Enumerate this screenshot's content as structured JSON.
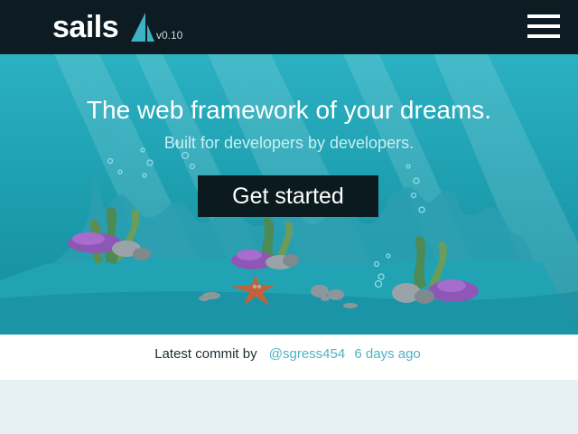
{
  "header": {
    "logo_text": "sails",
    "version": "v0.10",
    "menu_icon": "hamburger-icon"
  },
  "hero": {
    "title": "The web framework of your dreams.",
    "subtitle": "Built for developers by developers.",
    "cta_label": "Get started"
  },
  "commit": {
    "prefix": "Latest commit by",
    "author": "@sgress454",
    "time": "6 days ago"
  },
  "colors": {
    "header_bg": "#0c1c22",
    "hero_teal": "#1c9cad",
    "cta_bg": "#0b1a1f",
    "link": "#4db3c3",
    "footer_bg": "#e7f0f2"
  }
}
